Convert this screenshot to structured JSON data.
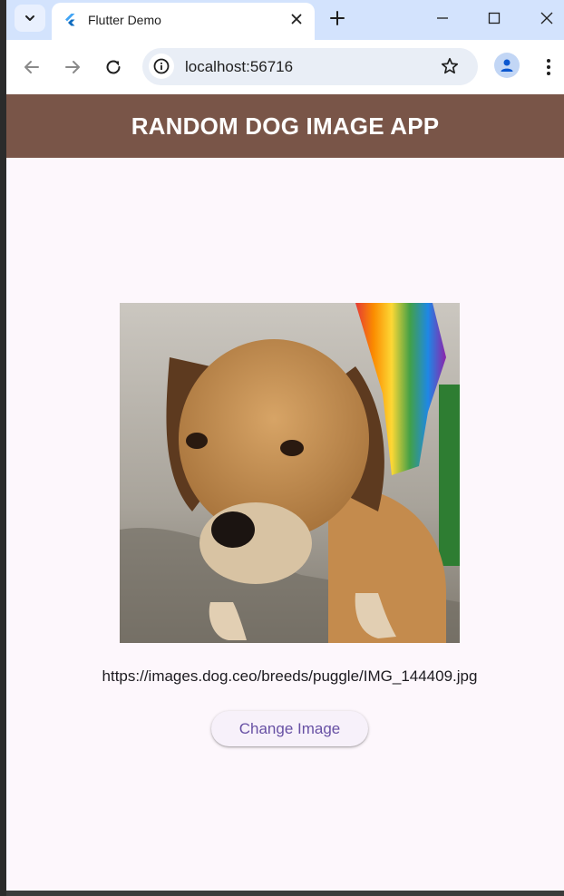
{
  "browser": {
    "tab_title": "Flutter Demo",
    "address": "localhost:56716"
  },
  "app": {
    "title": "RANDOM DOG IMAGE APP",
    "image_url_text": "https://images.dog.ceo/breeds/puggle/IMG_144409.jpg",
    "change_button_label": "Change Image"
  },
  "icons": {
    "tab_search": "chevron-down-icon",
    "favicon": "flutter-logo-icon",
    "tab_close": "close-icon",
    "new_tab": "plus-icon",
    "minimize": "minimize-icon",
    "maximize": "maximize-icon",
    "close_window": "close-icon",
    "back": "arrow-left-icon",
    "forward": "arrow-right-icon",
    "reload": "reload-icon",
    "site_info": "info-icon",
    "bookmark": "star-icon",
    "profile": "person-icon",
    "menu": "kebab-menu-icon"
  },
  "colors": {
    "app_bar": "#795548",
    "app_bar_text": "#ffffff",
    "page_background": "#fdf7fc",
    "button_text": "#6750a4",
    "tab_strip": "#d3e3fd",
    "omnibox": "#e9eef6"
  }
}
